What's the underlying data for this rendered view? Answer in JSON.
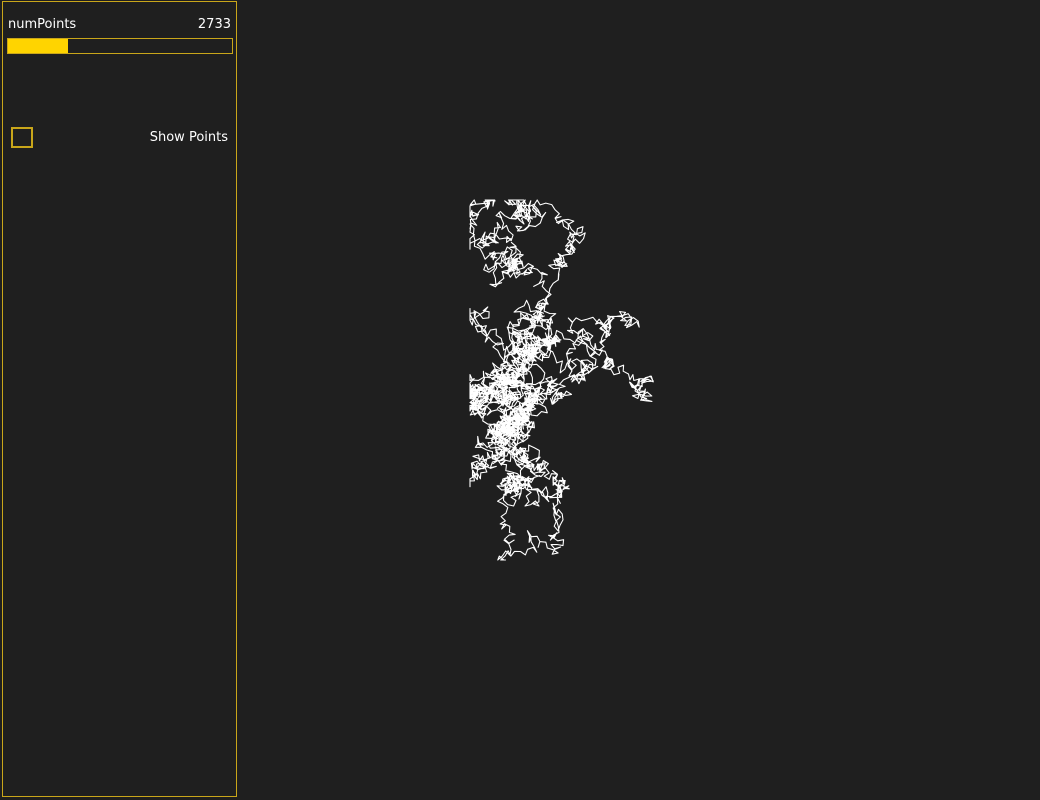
{
  "controls": {
    "num_points": {
      "label": "numPoints",
      "value": "2733",
      "fraction": 0.27
    },
    "show_points": {
      "label": "Show Points",
      "checked": false
    }
  },
  "colors": {
    "background": "#1f1f1f",
    "accent": "#ffd400",
    "border": "#c9a61a",
    "path": "#ffffff"
  }
}
